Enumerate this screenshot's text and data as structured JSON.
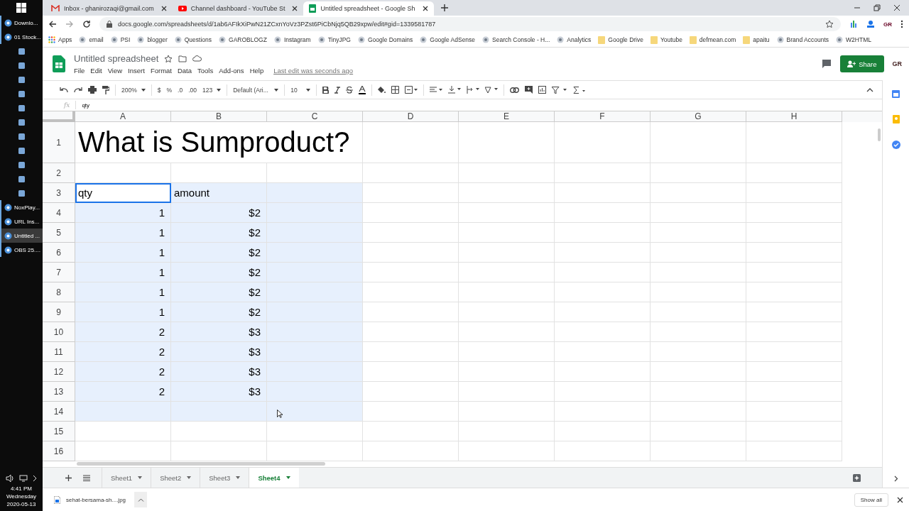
{
  "taskbar": {
    "items": [
      {
        "kind": "labeled",
        "label": "Downlo...",
        "selected": false
      },
      {
        "kind": "labeled",
        "label": "01 Stock...",
        "selected": false
      },
      {
        "kind": "icon",
        "selected": false
      },
      {
        "kind": "icon",
        "selected": false
      },
      {
        "kind": "icon",
        "selected": false
      },
      {
        "kind": "icon",
        "selected": false
      },
      {
        "kind": "icon",
        "selected": false
      },
      {
        "kind": "icon",
        "selected": false
      },
      {
        "kind": "icon",
        "selected": false
      },
      {
        "kind": "icon",
        "selected": false
      },
      {
        "kind": "icon",
        "selected": false
      },
      {
        "kind": "icon",
        "selected": false
      },
      {
        "kind": "icon",
        "selected": false
      },
      {
        "kind": "labeled",
        "label": "NoxPlay...",
        "selected": false
      },
      {
        "kind": "labeled",
        "label": "URL Ins...",
        "selected": false
      },
      {
        "kind": "labeled",
        "label": "Untitled ...",
        "selected": true
      },
      {
        "kind": "labeled",
        "label": "OBS 25....",
        "selected": false
      }
    ],
    "clock": {
      "time": "4:41 PM",
      "day": "Wednesday",
      "date": "2020-05-13"
    }
  },
  "browser": {
    "tabs": [
      {
        "title": "Inbox - ghanirozaqi@gmail.com",
        "kind": "mail",
        "selected": false
      },
      {
        "title": "Channel dashboard - YouTube St",
        "kind": "video",
        "selected": false
      },
      {
        "title": "Untitled spreadsheet - Google Sh",
        "kind": "sheets",
        "selected": true
      }
    ],
    "address": "docs.google.com/spreadsheets/d/1ab6AFIkXiPwN21ZCxnYoVz3PZst6PiCbNjq5QB29xpw/edit#gid=1339581787",
    "profile": "GR",
    "bookmarks": [
      {
        "label": "Apps",
        "kind": "apps"
      },
      {
        "label": "email",
        "kind": "site"
      },
      {
        "label": "PSI",
        "kind": "site"
      },
      {
        "label": "blogger",
        "kind": "site"
      },
      {
        "label": "Questions",
        "kind": "site"
      },
      {
        "label": "GAROBLOGZ",
        "kind": "site"
      },
      {
        "label": "Instagram",
        "kind": "site"
      },
      {
        "label": "TinyJPG",
        "kind": "site"
      },
      {
        "label": "Google Domains",
        "kind": "site"
      },
      {
        "label": "Google AdSense",
        "kind": "site"
      },
      {
        "label": "Search Console - H...",
        "kind": "site"
      },
      {
        "label": "Analytics",
        "kind": "site"
      },
      {
        "label": "Google Drive",
        "kind": "folder"
      },
      {
        "label": "Youtube",
        "kind": "folder"
      },
      {
        "label": "defmean.com",
        "kind": "folder"
      },
      {
        "label": "apaitu",
        "kind": "folder"
      },
      {
        "label": "Brand Accounts",
        "kind": "site"
      },
      {
        "label": "W2HTML",
        "kind": "site"
      }
    ]
  },
  "sheets": {
    "title": "Untitled spreadsheet",
    "menus": [
      "File",
      "Edit",
      "View",
      "Insert",
      "Format",
      "Data",
      "Tools",
      "Add-ons",
      "Help"
    ],
    "last_edit": "Last edit was seconds ago",
    "share": "Share",
    "avatar": "GR",
    "toolbar": {
      "zoom": "200%",
      "currency": "$",
      "percent": "%",
      "decrease_decimals": ".0",
      "increase_decimals": ".00",
      "format": "123",
      "font": "Default (Ari...",
      "size": "10"
    },
    "formula": {
      "label": "fx",
      "value": "qty"
    },
    "columns": [
      "A",
      "B",
      "C",
      "D",
      "E",
      "F",
      "G",
      "H"
    ],
    "rows": [
      {
        "number": "1",
        "cells": [
          {
            "text": "What is Sumproduct?",
            "kind": "title",
            "selected": false,
            "active": false
          }
        ]
      },
      {
        "number": "2",
        "cells": [
          {
            "selected": false,
            "active": false
          },
          {
            "selected": false,
            "active": false
          },
          {
            "selected": false,
            "active": false
          }
        ]
      },
      {
        "number": "3",
        "cells": [
          {
            "text": "qty",
            "kind": "text",
            "selected": false,
            "active": true
          },
          {
            "text": "amount",
            "kind": "text",
            "selected": true,
            "active": false
          },
          {
            "selected": true,
            "active": false
          }
        ]
      },
      {
        "number": "4",
        "cells": [
          {
            "text": "1",
            "kind": "number",
            "selected": true,
            "active": false
          },
          {
            "text": "$2",
            "kind": "number",
            "selected": true,
            "active": false
          },
          {
            "selected": true,
            "active": false
          }
        ]
      },
      {
        "number": "5",
        "cells": [
          {
            "text": "1",
            "kind": "number",
            "selected": true,
            "active": false
          },
          {
            "text": "$2",
            "kind": "number",
            "selected": true,
            "active": false
          },
          {
            "selected": true,
            "active": false
          }
        ]
      },
      {
        "number": "6",
        "cells": [
          {
            "text": "1",
            "kind": "number",
            "selected": true,
            "active": false
          },
          {
            "text": "$2",
            "kind": "number",
            "selected": true,
            "active": false
          },
          {
            "selected": true,
            "active": false
          }
        ]
      },
      {
        "number": "7",
        "cells": [
          {
            "text": "1",
            "kind": "number",
            "selected": true,
            "active": false
          },
          {
            "text": "$2",
            "kind": "number",
            "selected": true,
            "active": false
          },
          {
            "selected": true,
            "active": false
          }
        ]
      },
      {
        "number": "8",
        "cells": [
          {
            "text": "1",
            "kind": "number",
            "selected": true,
            "active": false
          },
          {
            "text": "$2",
            "kind": "number",
            "selected": true,
            "active": false
          },
          {
            "selected": true,
            "active": false
          }
        ]
      },
      {
        "number": "9",
        "cells": [
          {
            "text": "1",
            "kind": "number",
            "selected": true,
            "active": false
          },
          {
            "text": "$2",
            "kind": "number",
            "selected": true,
            "active": false
          },
          {
            "selected": true,
            "active": false
          }
        ]
      },
      {
        "number": "10",
        "cells": [
          {
            "text": "2",
            "kind": "number",
            "selected": true,
            "active": false
          },
          {
            "text": "$3",
            "kind": "number",
            "selected": true,
            "active": false
          },
          {
            "selected": true,
            "active": false
          }
        ]
      },
      {
        "number": "11",
        "cells": [
          {
            "text": "2",
            "kind": "number",
            "selected": true,
            "active": false
          },
          {
            "text": "$3",
            "kind": "number",
            "selected": true,
            "active": false
          },
          {
            "selected": true,
            "active": false
          }
        ]
      },
      {
        "number": "12",
        "cells": [
          {
            "text": "2",
            "kind": "number",
            "selected": true,
            "active": false
          },
          {
            "text": "$3",
            "kind": "number",
            "selected": true,
            "active": false
          },
          {
            "selected": true,
            "active": false
          }
        ]
      },
      {
        "number": "13",
        "cells": [
          {
            "text": "2",
            "kind": "number",
            "selected": true,
            "active": false
          },
          {
            "text": "$3",
            "kind": "number",
            "selected": true,
            "active": false
          },
          {
            "selected": true,
            "active": false
          }
        ]
      },
      {
        "number": "14",
        "cells": [
          {
            "selected": true,
            "active": false
          },
          {
            "selected": true,
            "active": false
          },
          {
            "selected": true,
            "active": false
          }
        ]
      },
      {
        "number": "15",
        "cells": [
          {
            "selected": false,
            "active": false
          },
          {
            "selected": false,
            "active": false
          },
          {
            "selected": false,
            "active": false
          }
        ]
      },
      {
        "number": "16",
        "cells": [
          {
            "selected": false,
            "active": false
          },
          {
            "selected": false,
            "active": false
          },
          {
            "selected": false,
            "active": false
          }
        ]
      }
    ],
    "sheet_tabs": [
      {
        "label": "Sheet1",
        "selected": false
      },
      {
        "label": "Sheet2",
        "selected": false
      },
      {
        "label": "Sheet3",
        "selected": false
      },
      {
        "label": "Sheet4",
        "selected": true
      }
    ]
  },
  "downloads": {
    "file": "sehat-bersama-sh....jpg",
    "show_all": "Show all"
  }
}
